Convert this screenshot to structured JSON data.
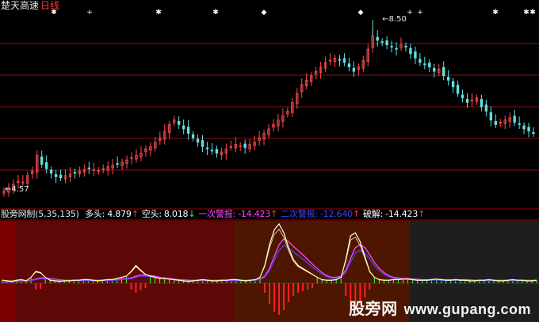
{
  "header": {
    "stock_name": "楚天高速",
    "period": "日线"
  },
  "indicator": {
    "name": "股旁网制",
    "params": "(5,35,135)",
    "items": [
      {
        "label": "多头:",
        "value": "4.879",
        "arrow": "↑",
        "color": "#ffffff",
        "value_color": "#ffffff",
        "arrow_color": "#ff3b3b"
      },
      {
        "label": "空头:",
        "value": "8.018",
        "arrow": "↓",
        "color": "#ffffff",
        "value_color": "#ffffff",
        "arrow_color": "#3bff3b"
      },
      {
        "label": "一次警报:",
        "value": "-14.423",
        "arrow": "↑",
        "color": "#ff44ff",
        "value_color": "#ff44ff",
        "arrow_color": "#ff3b3b"
      },
      {
        "label": "二次警报:",
        "value": "-12.640",
        "arrow": "↑",
        "color": "#4040ff",
        "value_color": "#4040ff",
        "arrow_color": "#ff3b3b"
      },
      {
        "label": "破解:",
        "value": "-14.423",
        "arrow": "↑",
        "color": "#ffffff",
        "value_color": "#ffffff",
        "arrow_color": "#ff3b3b"
      }
    ]
  },
  "watermark": {
    "cn": "股旁网",
    "url": "www.gupang.com"
  },
  "colors": {
    "up": "#ff4d4d",
    "down": "#5fe0e0",
    "grid": "#8a1010",
    "zone_dark": "#7a0000",
    "zone_red": "#5e0707",
    "zone_brown": "#4d1600",
    "zone_gray": "#1e1e1e"
  },
  "chart_data": {
    "type": "candlestick",
    "price_range": [
      4.57,
      8.5
    ],
    "high_label": "8.50",
    "low_label": "4.57",
    "closes": [
      4.6,
      4.68,
      4.75,
      4.82,
      4.8,
      4.95,
      5.05,
      5.4,
      5.2,
      5.1,
      5.0,
      4.92,
      4.9,
      4.95,
      4.98,
      5.02,
      5.05,
      5.08,
      5.1,
      5.08,
      5.06,
      5.1,
      5.15,
      5.18,
      5.2,
      5.25,
      5.3,
      5.35,
      5.4,
      5.45,
      5.55,
      5.6,
      5.7,
      5.8,
      5.95,
      6.1,
      6.2,
      6.1,
      6.0,
      5.9,
      5.8,
      5.7,
      5.6,
      5.55,
      5.5,
      5.45,
      5.48,
      5.55,
      5.6,
      5.65,
      5.62,
      5.58,
      5.65,
      5.7,
      5.8,
      5.9,
      6.0,
      6.1,
      6.2,
      6.3,
      6.4,
      6.6,
      6.8,
      7.0,
      7.1,
      7.2,
      7.3,
      7.4,
      7.5,
      7.55,
      7.6,
      7.55,
      7.5,
      7.4,
      7.3,
      7.4,
      7.55,
      7.8,
      8.1,
      8.0,
      7.95,
      7.9,
      7.85,
      7.8,
      7.9,
      7.85,
      7.7,
      7.6,
      7.5,
      7.45,
      7.4,
      7.3,
      7.35,
      7.2,
      7.1,
      6.95,
      6.8,
      6.7,
      6.6,
      6.65,
      6.7,
      6.5,
      6.4,
      6.2,
      6.1,
      6.15,
      6.2,
      6.25,
      6.15,
      6.1,
      6.0,
      5.95,
      5.9
    ],
    "indicator_lines": {
      "white": [
        0.05,
        0.04,
        0.03,
        0.05,
        0.06,
        0.04,
        0.1,
        0.2,
        0.18,
        0.1,
        0.05,
        0.04,
        0.03,
        0.04,
        0.04,
        0.05,
        0.05,
        0.06,
        0.06,
        0.05,
        0.04,
        0.05,
        0.06,
        0.06,
        0.08,
        0.1,
        0.12,
        0.2,
        0.3,
        0.22,
        0.15,
        0.12,
        0.1,
        0.08,
        0.08,
        0.07,
        0.06,
        0.05,
        0.04,
        0.03,
        0.04,
        0.05,
        0.06,
        0.05,
        0.04,
        0.04,
        0.05,
        0.05,
        0.06,
        0.06,
        0.05,
        0.04,
        0.05,
        0.06,
        0.1,
        0.3,
        0.65,
        0.9,
        1.0,
        0.85,
        0.6,
        0.4,
        0.3,
        0.25,
        0.2,
        0.15,
        0.1,
        0.06,
        0.05,
        0.05,
        0.06,
        0.1,
        0.4,
        0.8,
        0.85,
        0.7,
        0.45,
        0.2,
        0.1,
        0.06,
        0.05,
        0.05,
        0.06,
        0.06,
        0.07,
        0.07,
        0.06,
        0.05,
        0.05,
        0.05,
        0.06,
        0.07,
        0.06,
        0.05,
        0.05,
        0.06,
        0.05,
        0.05,
        0.04,
        0.04,
        0.05,
        0.05,
        0.06,
        0.05,
        0.04,
        0.04,
        0.05,
        0.06,
        0.05,
        0.05,
        0.04,
        0.04,
        0.05
      ],
      "magenta": [
        0.02,
        0.02,
        0.03,
        0.03,
        0.04,
        0.04,
        0.05,
        0.07,
        0.09,
        0.09,
        0.08,
        0.07,
        0.06,
        0.05,
        0.05,
        0.05,
        0.05,
        0.05,
        0.05,
        0.05,
        0.05,
        0.05,
        0.05,
        0.06,
        0.06,
        0.07,
        0.08,
        0.09,
        0.12,
        0.14,
        0.14,
        0.13,
        0.12,
        0.1,
        0.09,
        0.08,
        0.07,
        0.06,
        0.06,
        0.05,
        0.05,
        0.05,
        0.05,
        0.05,
        0.05,
        0.05,
        0.05,
        0.05,
        0.05,
        0.05,
        0.05,
        0.05,
        0.05,
        0.06,
        0.07,
        0.12,
        0.25,
        0.45,
        0.65,
        0.75,
        0.7,
        0.62,
        0.55,
        0.48,
        0.4,
        0.32,
        0.25,
        0.18,
        0.13,
        0.1,
        0.1,
        0.12,
        0.22,
        0.42,
        0.6,
        0.65,
        0.6,
        0.48,
        0.35,
        0.25,
        0.18,
        0.13,
        0.1,
        0.09,
        0.08,
        0.08,
        0.07,
        0.07,
        0.06,
        0.06,
        0.06,
        0.06,
        0.06,
        0.06,
        0.06,
        0.06,
        0.06,
        0.06,
        0.06,
        0.05,
        0.05,
        0.05,
        0.05,
        0.05,
        0.05,
        0.05,
        0.05,
        0.05,
        0.05,
        0.05,
        0.05,
        0.05,
        0.05
      ]
    }
  }
}
